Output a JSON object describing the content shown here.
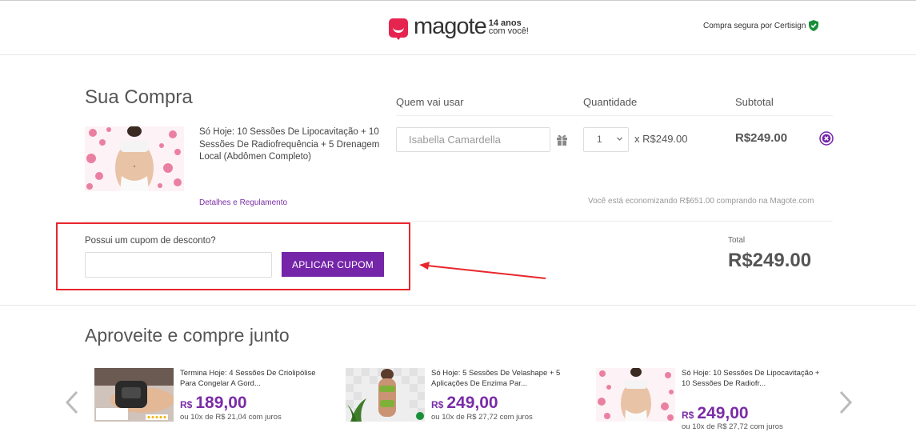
{
  "header": {
    "logo_text": "magote",
    "logo_tag_line1": "14 anos",
    "logo_tag_line2": "com você!",
    "secure_text": "Compra segura por Certisign"
  },
  "cart": {
    "title": "Sua Compra",
    "columns": {
      "user": "Quem vai usar",
      "quantity": "Quantidade",
      "subtotal": "Subtotal"
    },
    "item": {
      "name": "Só Hoje: 10 Sessões De Lipocavitação + 10 Sessões De Radiofrequência + 5 Drenagem Local (Abdômen Completo)",
      "details_link": "Detalhes e Regulamento",
      "user_value": "Isabella Camardella",
      "quantity": "1",
      "unit_price": "x R$249.00",
      "subtotal": "R$249.00",
      "savings": "Você está economizando R$651.00 comprando na Magote.com"
    }
  },
  "coupon": {
    "label": "Possui um cupom de desconto?",
    "input_value": "",
    "button": "APLICAR CUPOM"
  },
  "total": {
    "label": "Total",
    "value": "R$249.00"
  },
  "upsell": {
    "title": "Aproveite e compre junto",
    "items": [
      {
        "title": "Termina Hoje: 4 Sessões De Criolipólise Para Congelar A Gord...",
        "currency": "R$",
        "price": "189,00",
        "installments": "ou 10x de R$ 21,04 com juros"
      },
      {
        "title": "Só Hoje: 5 Sessões De Velashape + 5 Aplicações De Enzima Par...",
        "currency": "R$",
        "price": "249,00",
        "installments": "ou 10x de R$ 27,72 com juros"
      },
      {
        "title": "Só Hoje: 10 Sessões De Lipocavitação + 10 Sessões De Radiofr...",
        "currency": "R$",
        "price": "249,00",
        "installments": "ou 10x de R$ 27,72 com juros"
      }
    ]
  },
  "colors": {
    "brand_red": "#e5244f",
    "purple": "#7425a8",
    "highlight_red": "#e8262d",
    "secure_green": "#1a8f3a"
  }
}
